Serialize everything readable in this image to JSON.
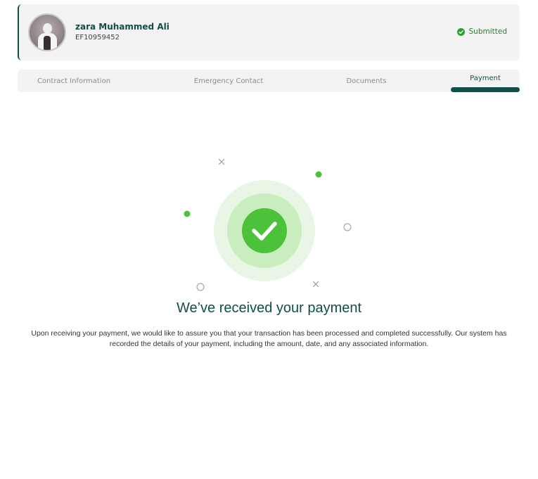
{
  "profile": {
    "name": "zara Muhammed Ali",
    "id": "EF10959452",
    "status": "Submitted",
    "status_color": "#2e9e3a"
  },
  "tabs": [
    {
      "label": "Contract Information",
      "active": false
    },
    {
      "label": "Emergency Contact",
      "active": false
    },
    {
      "label": "Documents",
      "active": false
    },
    {
      "label": "Payment",
      "active": true
    }
  ],
  "success": {
    "icon": "check-circle-icon",
    "title": "We’ve received your payment",
    "message": "Upon receiving your payment, we would like to assure you that your transaction has been processed and completed successfully. Our system has recorded the details of your payment, including the amount, date, and any associated information."
  },
  "colors": {
    "brand": "#0f4f45",
    "success": "#4cc13a",
    "tab_bg": "#f3f3f3"
  }
}
